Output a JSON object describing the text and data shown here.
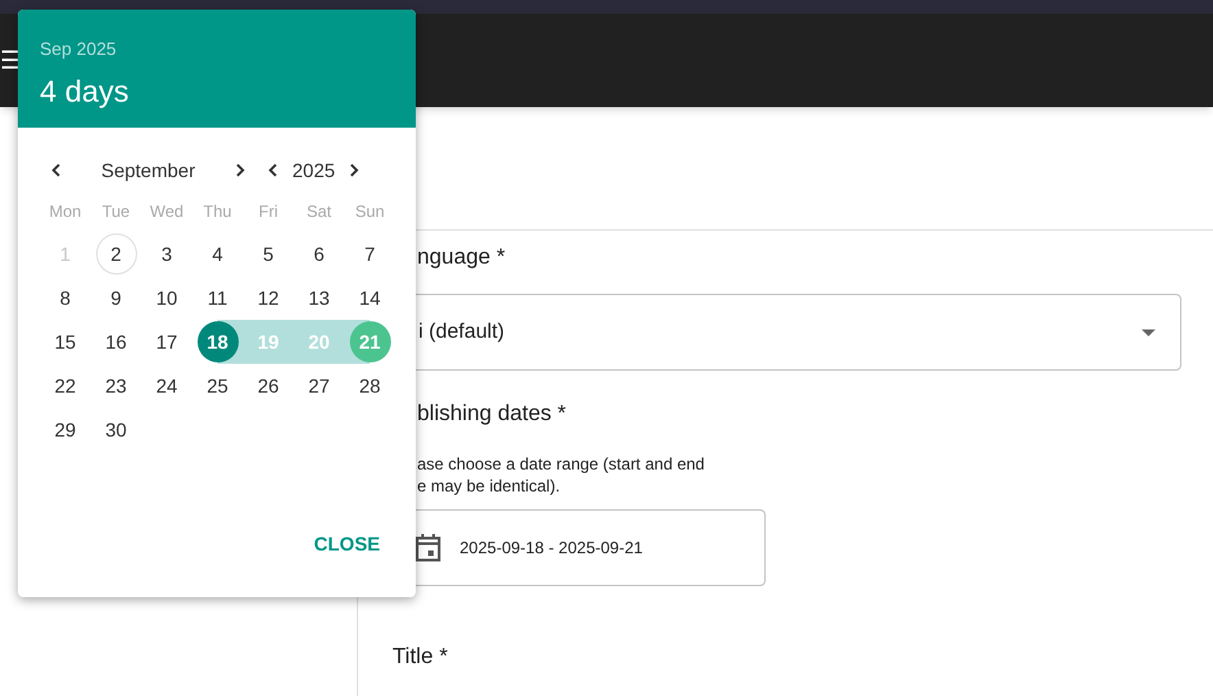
{
  "app_bar": {
    "menu_icon": "☰"
  },
  "form": {
    "language_label": "nguage *",
    "language_value": "i (default)",
    "dates_label": "blishing dates *",
    "dates_help": "ase choose a date range (start and end\ne may be identical).",
    "dates_value": "2025-09-18 - 2025-09-21",
    "title_label": "Title *"
  },
  "date_picker": {
    "header_month": "Sep 2025",
    "header_range": "4 days",
    "month": "September",
    "year": "2025",
    "close_button": "CLOSE",
    "weekdays": [
      "Mon",
      "Tue",
      "Wed",
      "Thu",
      "Fri",
      "Sat",
      "Sun"
    ],
    "weeks": [
      [
        {
          "day": "1",
          "kind": "disabled"
        },
        {
          "day": "2",
          "kind": "today"
        },
        {
          "day": "3",
          "kind": "normal"
        },
        {
          "day": "4",
          "kind": "normal"
        },
        {
          "day": "5",
          "kind": "normal"
        },
        {
          "day": "6",
          "kind": "normal"
        },
        {
          "day": "7",
          "kind": "normal"
        }
      ],
      [
        {
          "day": "8",
          "kind": "normal"
        },
        {
          "day": "9",
          "kind": "normal"
        },
        {
          "day": "10",
          "kind": "normal"
        },
        {
          "day": "11",
          "kind": "normal"
        },
        {
          "day": "12",
          "kind": "normal"
        },
        {
          "day": "13",
          "kind": "normal"
        },
        {
          "day": "14",
          "kind": "normal"
        }
      ],
      [
        {
          "day": "15",
          "kind": "normal"
        },
        {
          "day": "16",
          "kind": "normal"
        },
        {
          "day": "17",
          "kind": "normal"
        },
        {
          "day": "18",
          "kind": "range_start"
        },
        {
          "day": "19",
          "kind": "in_range"
        },
        {
          "day": "20",
          "kind": "in_range"
        },
        {
          "day": "21",
          "kind": "range_end"
        }
      ],
      [
        {
          "day": "22",
          "kind": "normal"
        },
        {
          "day": "23",
          "kind": "normal"
        },
        {
          "day": "24",
          "kind": "normal"
        },
        {
          "day": "25",
          "kind": "normal"
        },
        {
          "day": "26",
          "kind": "normal"
        },
        {
          "day": "27",
          "kind": "normal"
        },
        {
          "day": "28",
          "kind": "normal"
        }
      ],
      [
        {
          "day": "29",
          "kind": "normal"
        },
        {
          "day": "30",
          "kind": "normal"
        }
      ]
    ]
  }
}
